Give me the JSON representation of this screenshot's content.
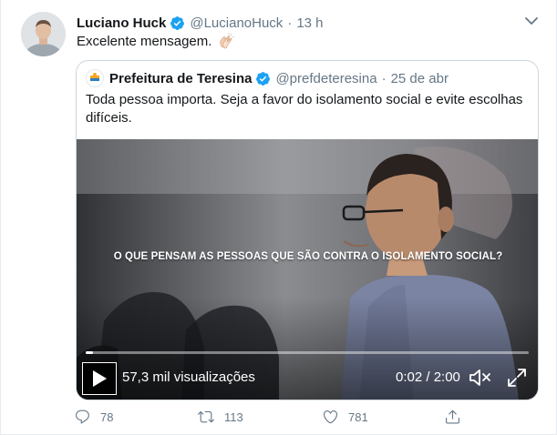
{
  "author": {
    "name": "Luciano Huck",
    "handle": "@LucianoHuck",
    "separator": "·",
    "time": "13 h",
    "verified": true,
    "avatar_icon": "profile-photo"
  },
  "tweet": {
    "text": "Excelente mensagem.",
    "emoji_icon": "clapping-hands-icon"
  },
  "quoted": {
    "name": "Prefeitura de Teresina",
    "handle": "@prefdeteresina",
    "separator": "·",
    "time": "25 de abr",
    "text": "Toda pessoa importa. Seja a favor do isolamento social e evite escolhas difíceis.",
    "avatar_icon": "city-logo-icon"
  },
  "video": {
    "caption": "O QUE PENSAM AS PESSOAS QUE SÃO CONTRA O ISOLAMENTO SOCIAL?",
    "views": "57,3 mil visualizações",
    "time_display": "0:02 / 2:00",
    "progress": 0.017,
    "muted": true
  },
  "actions": {
    "replies": "78",
    "retweets": "113",
    "likes": "781"
  },
  "colors": {
    "verified_blue": "#1da1f2",
    "secondary_text": "#657786",
    "border": "#ccd6dd"
  }
}
